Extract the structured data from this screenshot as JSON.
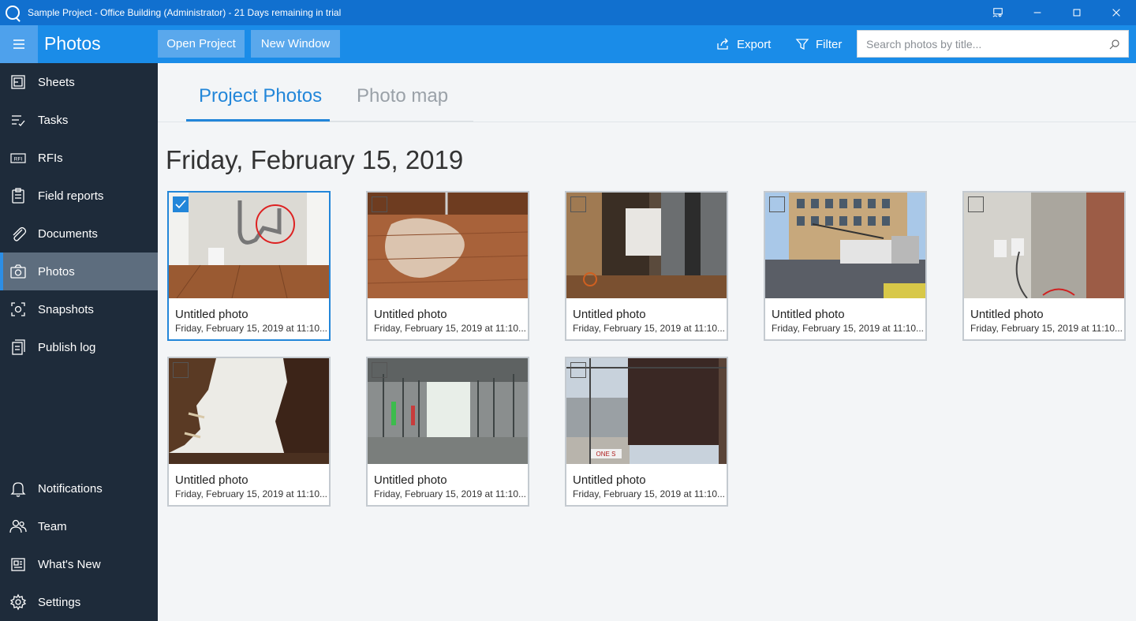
{
  "window": {
    "title": "Sample Project - Office Building (Administrator) - 21 Days remaining in trial"
  },
  "toolbar": {
    "section_title": "Photos",
    "open_project": "Open Project",
    "new_window": "New Window",
    "export": "Export",
    "filter": "Filter",
    "search_placeholder": "Search photos by title..."
  },
  "sidebar": {
    "items": [
      {
        "label": "Sheets",
        "icon": "sheets-icon"
      },
      {
        "label": "Tasks",
        "icon": "tasks-icon"
      },
      {
        "label": "RFIs",
        "icon": "rfi-icon"
      },
      {
        "label": "Field reports",
        "icon": "clipboard-icon"
      },
      {
        "label": "Documents",
        "icon": "paperclip-icon"
      },
      {
        "label": "Photos",
        "icon": "camera-icon",
        "active": true
      },
      {
        "label": "Snapshots",
        "icon": "snapshot-icon"
      },
      {
        "label": "Publish log",
        "icon": "publish-log-icon"
      }
    ],
    "bottom_items": [
      {
        "label": "Notifications",
        "icon": "bell-icon"
      },
      {
        "label": "Team",
        "icon": "team-icon"
      },
      {
        "label": "What's New",
        "icon": "news-icon"
      },
      {
        "label": "Settings",
        "icon": "gear-icon"
      }
    ]
  },
  "tabs": {
    "project_photos": "Project Photos",
    "photo_map": "Photo map"
  },
  "date_heading": "Friday, February 15, 2019",
  "photos": [
    {
      "title": "Untitled photo",
      "subtitle": "Friday, February 15, 2019 at 11:10...",
      "selected": true
    },
    {
      "title": "Untitled photo",
      "subtitle": "Friday, February 15, 2019 at 11:10...",
      "selected": false
    },
    {
      "title": "Untitled photo",
      "subtitle": "Friday, February 15, 2019 at 11:10...",
      "selected": false
    },
    {
      "title": "Untitled photo",
      "subtitle": "Friday, February 15, 2019 at 11:10...",
      "selected": false
    },
    {
      "title": "Untitled photo",
      "subtitle": "Friday, February 15, 2019 at 11:10...",
      "selected": false
    },
    {
      "title": "Untitled photo",
      "subtitle": "Friday, February 15, 2019 at 11:10...",
      "selected": false
    },
    {
      "title": "Untitled photo",
      "subtitle": "Friday, February 15, 2019 at 11:10...",
      "selected": false
    },
    {
      "title": "Untitled photo",
      "subtitle": "Friday, February 15, 2019 at 11:10...",
      "selected": false
    }
  ],
  "colors": {
    "titlebar": "#1170cf",
    "toolbar": "#1a8ce8",
    "sidebar": "#1e2b3a",
    "sidebar_active": "#5d6d7e",
    "accent": "#2286d9"
  }
}
